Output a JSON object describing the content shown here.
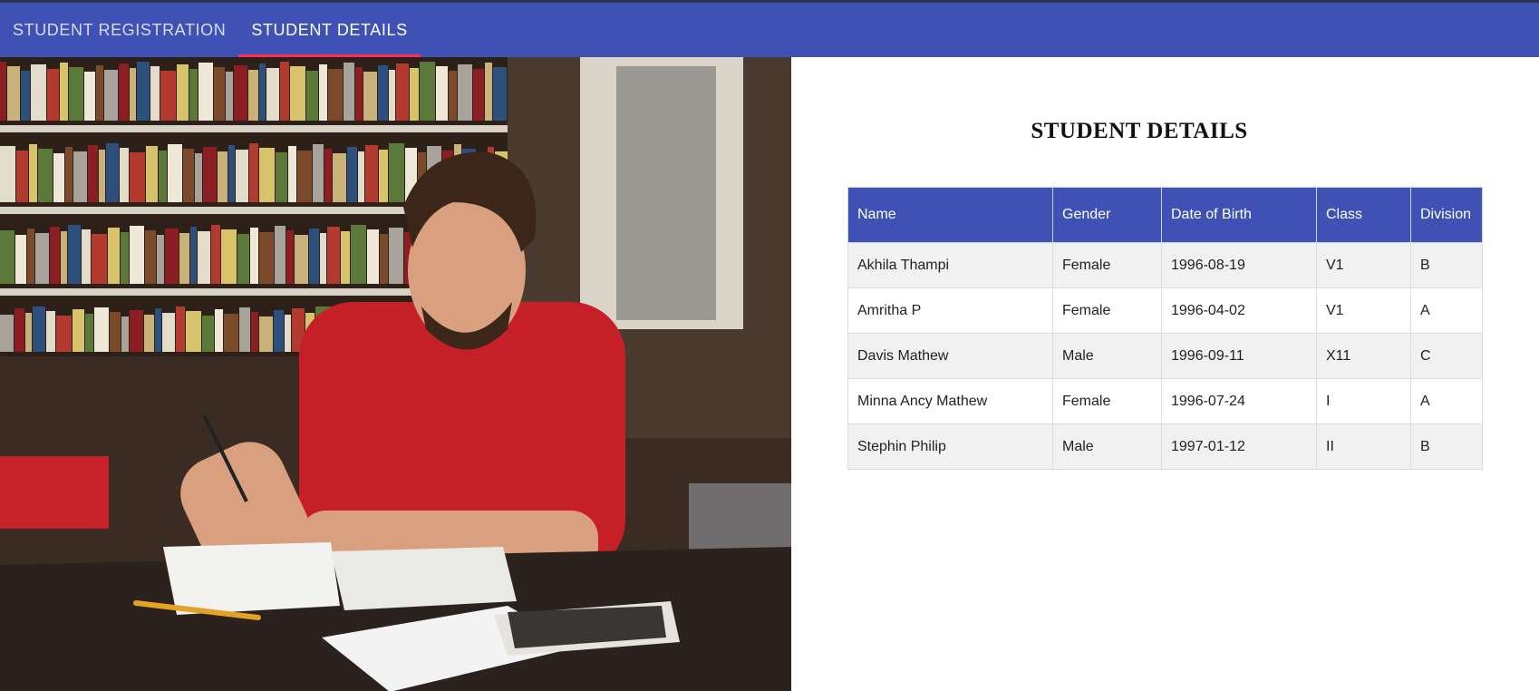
{
  "nav": {
    "tabs": [
      {
        "label": "STUDENT REGISTRATION",
        "active": false
      },
      {
        "label": "STUDENT DETAILS",
        "active": true
      }
    ],
    "accent_color": "#3f51b5",
    "active_indicator_color": "#ff2d55"
  },
  "hero": {
    "icon": "student-studying-photo"
  },
  "main": {
    "title": "STUDENT DETAILS",
    "table": {
      "headers": [
        "Name",
        "Gender",
        "Date of Birth",
        "Class",
        "Division"
      ],
      "rows": [
        [
          "Akhila Thampi",
          "Female",
          "1996-08-19",
          "V1",
          "B"
        ],
        [
          "Amritha P",
          "Female",
          "1996-04-02",
          "V1",
          "A"
        ],
        [
          "Davis Mathew",
          "Male",
          "1996-09-11",
          "X11",
          "C"
        ],
        [
          "Minna Ancy Mathew",
          "Female",
          "1996-07-24",
          "I",
          "A"
        ],
        [
          "Stephin Philip",
          "Male",
          "1997-01-12",
          "II",
          "B"
        ]
      ]
    }
  }
}
